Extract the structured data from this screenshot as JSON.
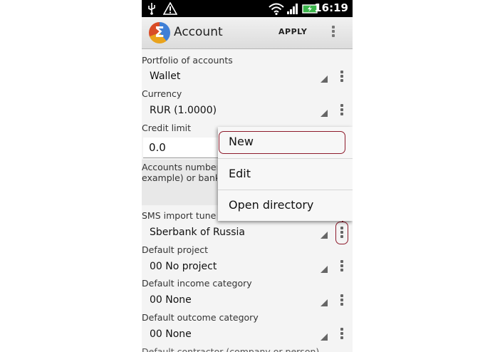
{
  "status_bar": {
    "time": "16:19"
  },
  "header": {
    "title": "Account",
    "apply_label": "APPLY"
  },
  "fields": {
    "portfolio": {
      "label": "Portfolio of accounts",
      "value": "Wallet"
    },
    "currency": {
      "label": "Currency",
      "value": "RUR (1.0000)"
    },
    "credit_limit": {
      "label": "Credit limit",
      "value": "0.0"
    },
    "accounts_number": {
      "label_line1": "Accounts number o",
      "label_line2": "example) or bank S"
    },
    "sms_import": {
      "label": "SMS import tune",
      "value": "Sberbank of Russia"
    },
    "default_project": {
      "label": "Default project",
      "value": "00 No project"
    },
    "default_income": {
      "label": "Default income category",
      "value": "00 None"
    },
    "default_outcome": {
      "label": "Default outcome category",
      "value": "00 None"
    },
    "default_contractor": {
      "label": "Default contractor (company or person)"
    }
  },
  "popup_menu": {
    "items": [
      {
        "label": "New"
      },
      {
        "label": "Edit"
      },
      {
        "label": "Open directory"
      }
    ]
  },
  "colors": {
    "annotation": "#8d1a2b",
    "status_bar": "#000000"
  }
}
